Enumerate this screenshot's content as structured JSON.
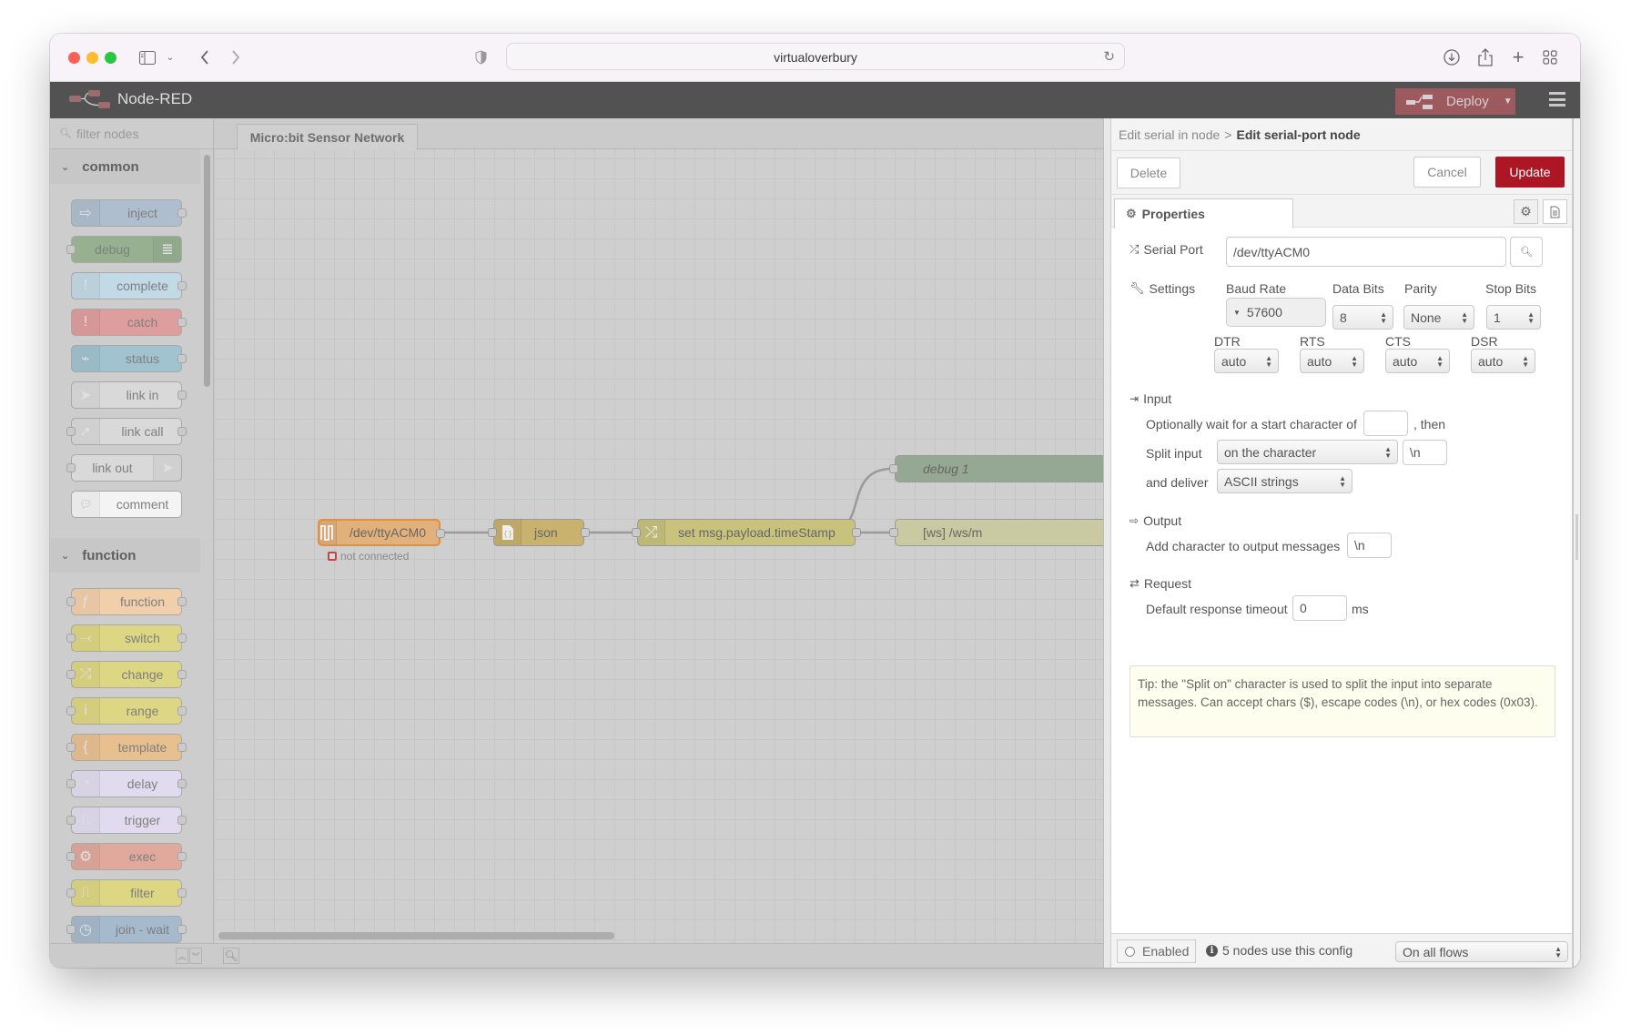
{
  "browser": {
    "url": "virtualoverbury",
    "icons": [
      "sidebar-toggle-icon",
      "chevron-down-icon",
      "back-icon",
      "forward-icon",
      "privacy-shield-icon",
      "reload-icon",
      "download-icon",
      "share-icon",
      "new-tab-icon",
      "tab-overview-icon"
    ]
  },
  "app": {
    "title": "Node-RED",
    "deploy_label": "Deploy"
  },
  "palette": {
    "filter_placeholder": "filter nodes",
    "categories": [
      {
        "name": "common",
        "nodes": [
          {
            "label": "inject",
            "color": "#a6bbcf",
            "icon": "arrow-in-icon",
            "in": false,
            "out": true
          },
          {
            "label": "debug",
            "color": "#87a980",
            "icon": "list-icon",
            "in": true,
            "out": false,
            "icon_right": true
          },
          {
            "label": "complete",
            "color": "#c0deed",
            "icon": "exclamation-icon",
            "in": false,
            "out": true
          },
          {
            "label": "catch",
            "color": "#e49191",
            "icon": "exclamation-icon",
            "in": false,
            "out": true
          },
          {
            "label": "status",
            "color": "#94c1d0",
            "icon": "pulse-icon",
            "in": false,
            "out": true
          },
          {
            "label": "link in",
            "color": "#dddddd",
            "icon": "link-in-icon",
            "in": false,
            "out": true
          },
          {
            "label": "link call",
            "color": "#dddddd",
            "icon": "link-call-icon",
            "in": true,
            "out": true
          },
          {
            "label": "link out",
            "color": "#dddddd",
            "icon": "link-out-icon",
            "in": true,
            "out": false,
            "icon_right": true
          },
          {
            "label": "comment",
            "color": "#ffffff",
            "icon": "comment-icon",
            "in": false,
            "out": false
          }
        ]
      },
      {
        "name": "function",
        "nodes": [
          {
            "label": "function",
            "color": "#fdd0a2",
            "icon": "function-icon",
            "in": true,
            "out": true
          },
          {
            "label": "switch",
            "color": "#e2d96e",
            "icon": "switch-icon",
            "in": true,
            "out": true
          },
          {
            "label": "change",
            "color": "#e2d96e",
            "icon": "shuffle-icon",
            "in": true,
            "out": true
          },
          {
            "label": "range",
            "color": "#e2d96e",
            "icon": "range-icon",
            "in": true,
            "out": true
          },
          {
            "label": "template",
            "color": "#f0bd80",
            "icon": "brace-icon",
            "in": true,
            "out": true
          },
          {
            "label": "delay",
            "color": "#e6e0f8",
            "icon": "timer-icon",
            "in": true,
            "out": true
          },
          {
            "label": "trigger",
            "color": "#e6e0f8",
            "icon": "trigger-icon",
            "in": true,
            "out": true
          },
          {
            "label": "exec",
            "color": "#e7a08f",
            "icon": "gear-icon",
            "in": true,
            "out": true
          },
          {
            "label": "filter",
            "color": "#e2d96e",
            "icon": "filter-icon",
            "in": true,
            "out": true
          },
          {
            "label": "join - wait",
            "color": "#9bb5cc",
            "icon": "clock-icon",
            "in": true,
            "out": true
          }
        ]
      }
    ]
  },
  "workspace": {
    "tab": "Micro:bit Sensor Network",
    "nodes": [
      {
        "id": "serial",
        "label": "/dev/ttyACM0",
        "color": "#f0c890",
        "icon": "serial-icon",
        "status": "not connected",
        "selected": true
      },
      {
        "id": "json",
        "label": "json",
        "color": "#e8c96e",
        "icon": "json-icon"
      },
      {
        "id": "change",
        "label": "set msg.payload.timeStamp",
        "color": "#e2d96e",
        "icon": "shuffle-icon"
      },
      {
        "id": "debug",
        "label": "debug 1",
        "color": "#87a980",
        "italic": true
      },
      {
        "id": "ws",
        "label": "[ws] /ws/m",
        "color": "#d8d8a8"
      }
    ]
  },
  "editor": {
    "breadcrumb_parent": "Edit serial in node",
    "breadcrumb_sep": ">",
    "breadcrumb_current": "Edit serial-port node",
    "delete_label": "Delete",
    "cancel_label": "Cancel",
    "update_label": "Update",
    "tab_properties": "Properties",
    "serial_port_label": "Serial Port",
    "serial_port_value": "/dev/ttyACM0",
    "settings_label": "Settings",
    "baud_rate_label": "Baud Rate",
    "baud_rate_value": "57600",
    "data_bits_label": "Data Bits",
    "data_bits_value": "8",
    "parity_label": "Parity",
    "parity_value": "None",
    "stop_bits_label": "Stop Bits",
    "stop_bits_value": "1",
    "dtr_label": "DTR",
    "dtr_value": "auto",
    "rts_label": "RTS",
    "rts_value": "auto",
    "cts_label": "CTS",
    "cts_value": "auto",
    "dsr_label": "DSR",
    "dsr_value": "auto",
    "input_label": "Input",
    "wait_text": "Optionally wait for a start character of",
    "wait_value": "",
    "then_text": ", then",
    "split_label": "Split input",
    "split_value": "on the character",
    "split_char": "\\n",
    "deliver_label": "and deliver",
    "deliver_value": "ASCII strings",
    "output_label": "Output",
    "add_char_label": "Add character to output messages",
    "add_char_value": "\\n",
    "request_label": "Request",
    "timeout_label": "Default response timeout",
    "timeout_value": "0",
    "timeout_unit": "ms",
    "tip": "Tip: the \"Split on\" character is used to split the input into separate messages. Can accept chars ($), escape codes (\\n), or hex codes (0x03).",
    "enabled_label": "Enabled",
    "usage_text": "5 nodes use this config",
    "scope_value": "On all flows"
  },
  "colors": {
    "update": "#ad1625",
    "deploy": "#9c5a5f",
    "header": "#525252"
  }
}
